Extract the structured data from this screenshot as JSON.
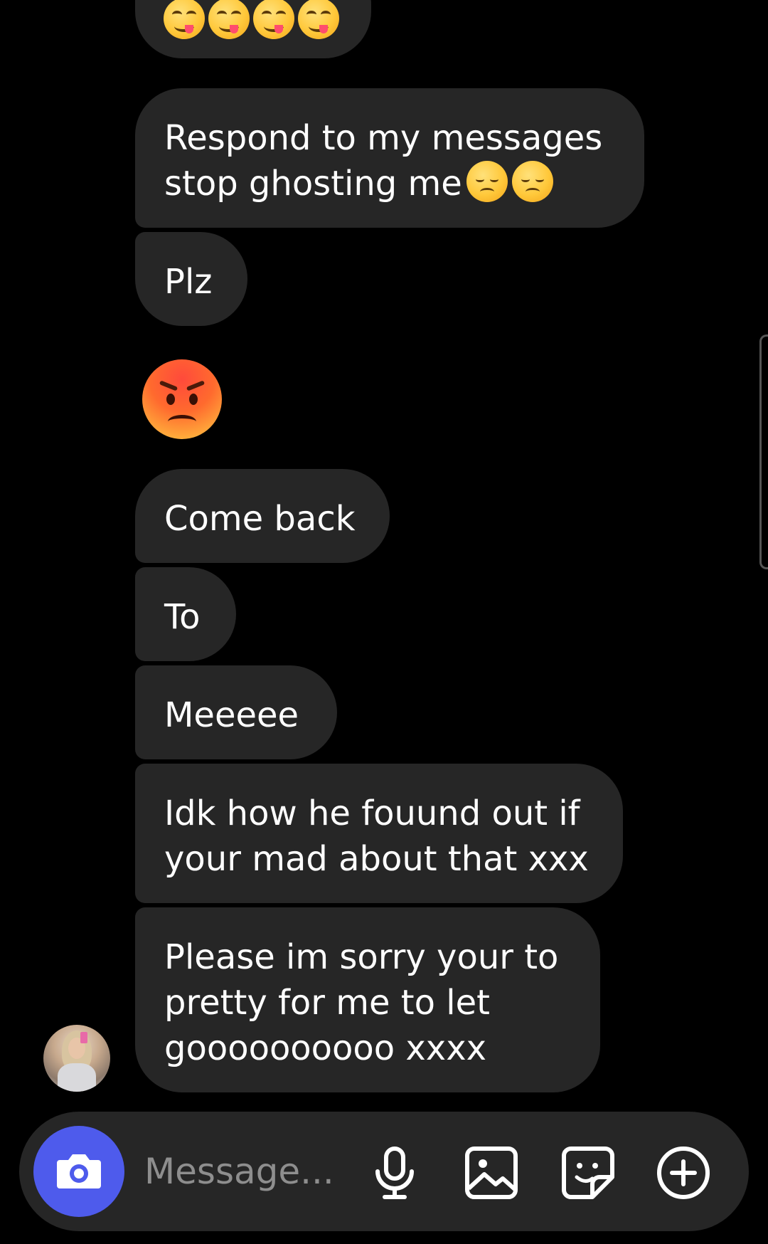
{
  "conversation": {
    "messages": [
      {
        "id": "m1",
        "text": "Respond to my messages\nstop ghosting me",
        "trailing_emoji": [
          "disappointed-face",
          "disappointed-face"
        ]
      },
      {
        "id": "m2",
        "text": "Plz"
      },
      {
        "id": "m3",
        "emoji": "angry-face"
      },
      {
        "id": "m4",
        "text": "Come back"
      },
      {
        "id": "m5",
        "text": "To"
      },
      {
        "id": "m6",
        "text": "Meeeee"
      },
      {
        "id": "m7",
        "line1": "Idk how he fouund out if",
        "line2": "your mad about that xxx"
      },
      {
        "id": "m8",
        "line1": "Please im sorry your to",
        "line2": "pretty for me to let",
        "line3": "goooooooooo xxxx"
      }
    ],
    "m1_line1": "Respond to my messages",
    "m1_line2": "stop ghosting me",
    "top_partial_emoji": [
      "face-savoring-food",
      "face-savoring-food",
      "face-savoring-food",
      "face-savoring-food"
    ]
  },
  "composer": {
    "placeholder": "Message...",
    "icons": [
      "camera-icon",
      "microphone-icon",
      "gallery-icon",
      "sticker-icon",
      "add-icon"
    ],
    "camera_color": "#4e5bec"
  },
  "colors": {
    "background": "#000000",
    "bubble": "#262626",
    "text": "#ffffff",
    "placeholder": "#8e8e8e"
  }
}
